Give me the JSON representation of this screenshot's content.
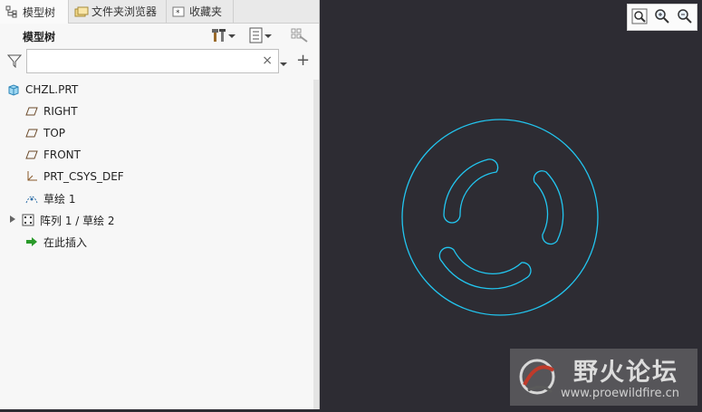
{
  "tabs": [
    {
      "label": "模型树"
    },
    {
      "label": "文件夹浏览器"
    },
    {
      "label": "收藏夹"
    }
  ],
  "panel": {
    "title": "模型树"
  },
  "filter": {
    "placeholder": "",
    "clear_glyph": "×",
    "add_glyph": "+"
  },
  "tree": [
    {
      "label": "CHZL.PRT",
      "icon": "part-icon"
    },
    {
      "label": "RIGHT",
      "icon": "datum-plane-icon"
    },
    {
      "label": "TOP",
      "icon": "datum-plane-icon"
    },
    {
      "label": "FRONT",
      "icon": "datum-plane-icon"
    },
    {
      "label": "PRT_CSYS_DEF",
      "icon": "csys-icon"
    },
    {
      "label": "草绘 1",
      "icon": "sketch-icon"
    },
    {
      "label": "阵列 1 / 草绘 2",
      "icon": "pattern-icon",
      "expandable": true
    },
    {
      "label": "在此插入",
      "icon": "insert-here-icon"
    }
  ],
  "watermark": {
    "title": "野火论坛",
    "url": "www.proewildfire.cn"
  },
  "colors": {
    "canvas": "#2d2c33",
    "sketch": "#22c6f0"
  }
}
